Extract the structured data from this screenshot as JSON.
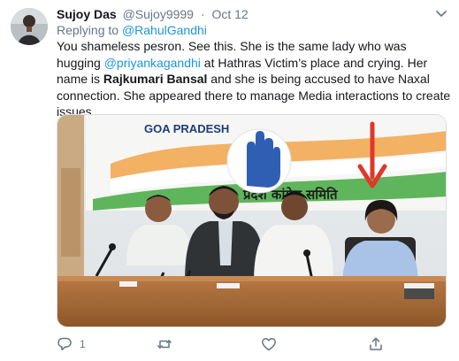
{
  "tweet": {
    "author_name": "Sujoy Das",
    "author_handle": "@Sujoy9999",
    "separator": "·",
    "date": "Oct 12",
    "replying_prefix": "Replying to ",
    "replying_to": "@RahulGandhi",
    "text_1": "You shameless pesron. See this. She is the same lady who was hugging ",
    "mention": "@priyankagandhi",
    "text_2": " at Hathras Victim’s place and crying. Her name is ",
    "bold_name": "Rajkumari Bansal",
    "text_3": " and she is being accused to have Naxal connection. She appeared there to manage Media interactions to create issues"
  },
  "media": {
    "banner_left": "GOA PRADESH",
    "banner_right": "प्रदेश कांग्रेस समिति",
    "arrow_color": "#e0362c"
  },
  "actions": {
    "reply": {
      "icon": "reply-icon",
      "count": "1"
    },
    "retweet": {
      "icon": "retweet-icon",
      "count": ""
    },
    "like": {
      "icon": "heart-icon",
      "count": ""
    },
    "share": {
      "icon": "share-icon"
    }
  },
  "colors": {
    "link": "#1b95e0",
    "secondary_text": "#657786",
    "primary_text": "#14171a"
  }
}
